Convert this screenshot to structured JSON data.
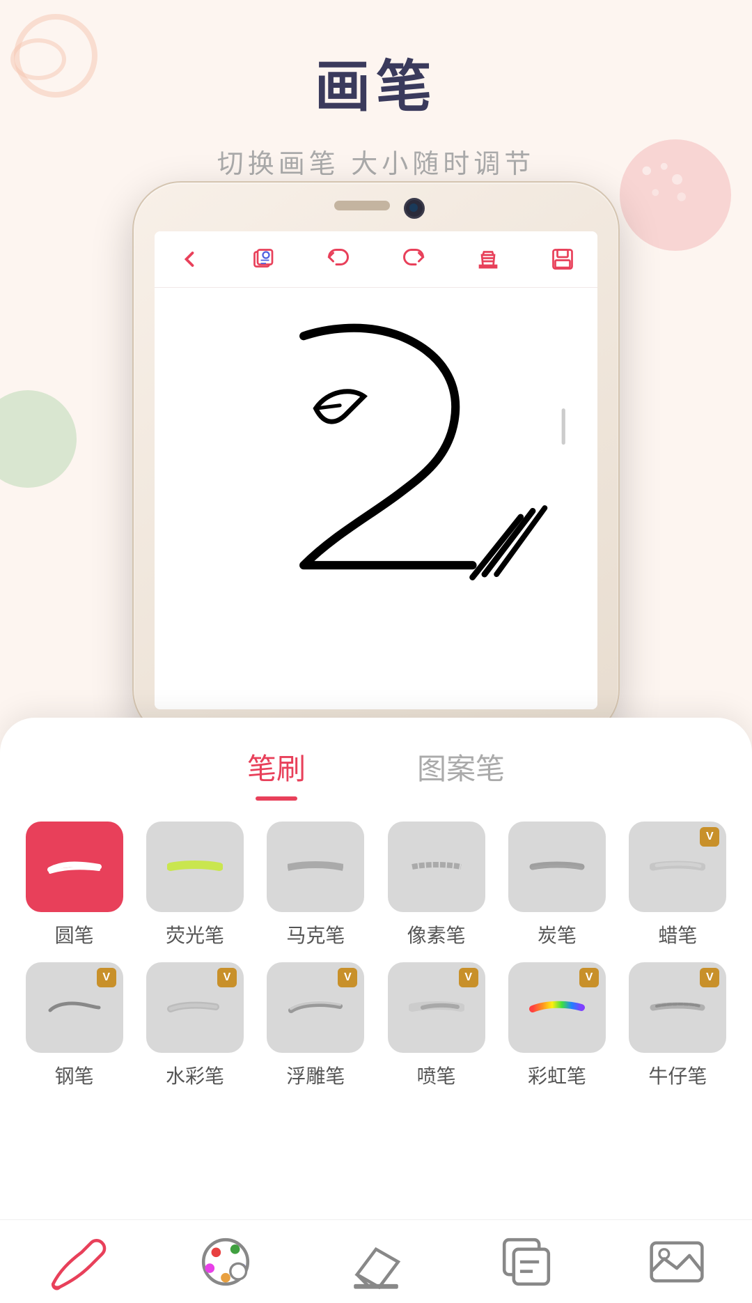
{
  "page": {
    "title": "画笔",
    "subtitle": "切换画笔  大小随时调节"
  },
  "tabs": {
    "brush": "笔刷",
    "pattern": "图案笔"
  },
  "brushes_row1": [
    {
      "id": "round",
      "label": "圆笔",
      "active": true,
      "premium": false
    },
    {
      "id": "highlight",
      "label": "荧光笔",
      "active": false,
      "premium": false
    },
    {
      "id": "marker",
      "label": "马克笔",
      "active": false,
      "premium": false
    },
    {
      "id": "pixel",
      "label": "像素笔",
      "active": false,
      "premium": false
    },
    {
      "id": "charcoal",
      "label": "炭笔",
      "active": false,
      "premium": false
    },
    {
      "id": "wax",
      "label": "蜡笔",
      "active": false,
      "premium": true
    }
  ],
  "brushes_row2": [
    {
      "id": "ink",
      "label": "钢笔",
      "active": false,
      "premium": true
    },
    {
      "id": "watercolor",
      "label": "水彩笔",
      "active": false,
      "premium": true
    },
    {
      "id": "emboss",
      "label": "浮雕笔",
      "active": false,
      "premium": true
    },
    {
      "id": "spray",
      "label": "喷笔",
      "active": false,
      "premium": true
    },
    {
      "id": "rainbow",
      "label": "彩虹笔",
      "active": false,
      "premium": true
    },
    {
      "id": "denim",
      "label": "牛仔笔",
      "active": false,
      "premium": true
    }
  ],
  "toolbar": {
    "back": "‹",
    "layer": "layer-icon",
    "undo": "undo-icon",
    "redo": "redo-icon",
    "clear": "clear-icon",
    "save": "save-icon"
  },
  "bottomNav": {
    "brush": "brush-nav",
    "palette": "palette-nav",
    "eraser": "eraser-nav",
    "layers": "layers-nav",
    "gallery": "gallery-nav"
  },
  "colors": {
    "accent": "#e8405a",
    "background": "#fdf5f0",
    "premium_badge": "#c8902a",
    "text_dark": "#3a3a5c",
    "text_gray": "#999999"
  }
}
